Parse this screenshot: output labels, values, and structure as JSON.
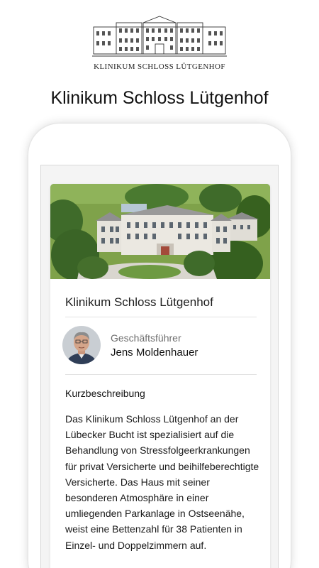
{
  "logo": {
    "text": "KLINIKUM SCHLOSS LÜTGENHOF"
  },
  "header": {
    "title": "Klinikum Schloss Lütgenhof"
  },
  "card": {
    "clinic_name": "Klinikum Schloss Lütgenhof",
    "manager": {
      "role": "Geschäftsführer",
      "name": "Jens Moldenhauer"
    },
    "section_title": "Kurzbeschreibung",
    "description": "Das Klinikum Schloss Lütgenhof an der Lübecker Bucht ist spezialisiert auf die Behandlung von Stressfolgeerkrankungen für privat Versicherte und beihilfeberechtigte Versicherte. Das Haus mit seiner besonderen Atmosphäre in einer umliegenden Parkanlage in Ostseenähe, weist eine Bettenzahl für 38 Patienten in Einzel- und Doppelzimmern auf."
  },
  "colors": {
    "background": "#ffffff",
    "text": "#1a1a1a",
    "muted": "#6e6e6e",
    "divider": "#e2e2e2",
    "screen_bg": "#f4f4f4"
  }
}
